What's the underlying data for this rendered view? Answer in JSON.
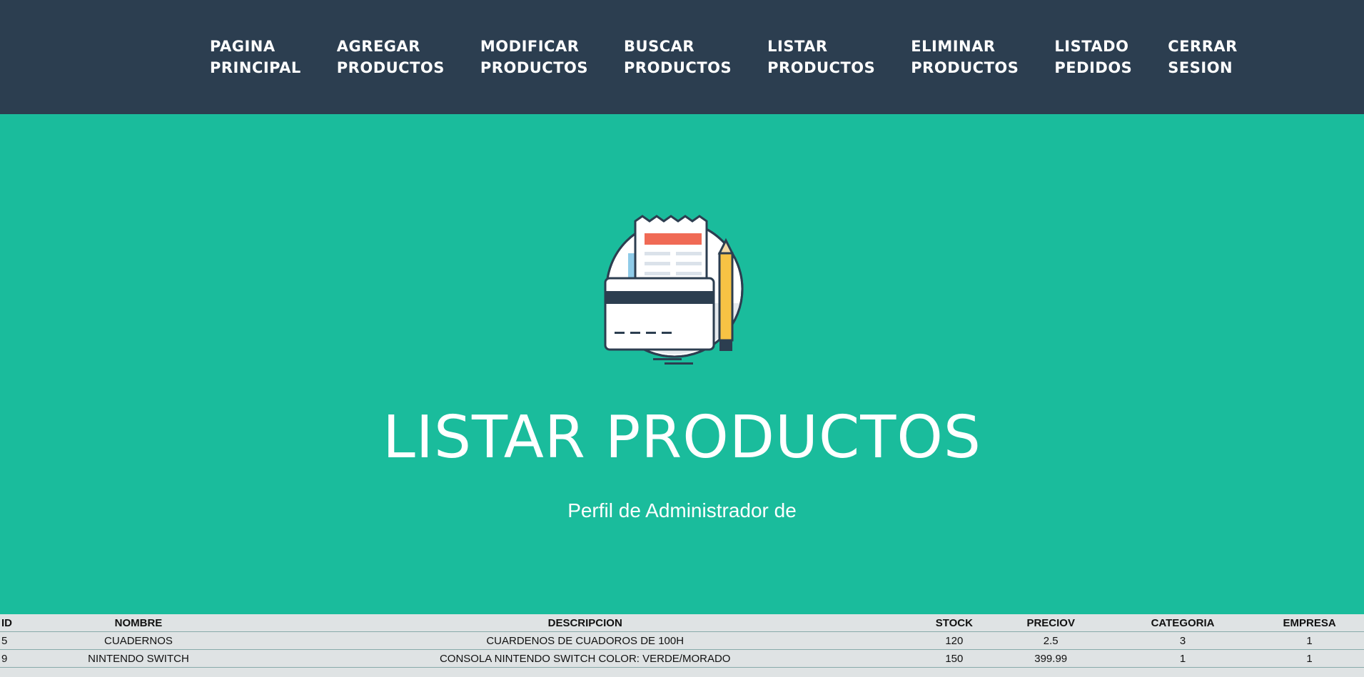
{
  "nav": {
    "items": [
      {
        "line1": "PAGINA",
        "line2": "PRINCIPAL"
      },
      {
        "line1": "AGREGAR",
        "line2": "PRODUCTOS"
      },
      {
        "line1": "MODIFICAR",
        "line2": "PRODUCTOS"
      },
      {
        "line1": "BUSCAR",
        "line2": "PRODUCTOS"
      },
      {
        "line1": "LISTAR",
        "line2": "PRODUCTOS"
      },
      {
        "line1": "ELIMINAR",
        "line2": "PRODUCTOS"
      },
      {
        "line1": "LISTADO",
        "line2": "PEDIDOS"
      },
      {
        "line1": "CERRAR",
        "line2": "SESION"
      }
    ]
  },
  "hero": {
    "illustration_icon": "payment-receipt-card-pencil-icon",
    "title": "LISTAR PRODUCTOS",
    "subtitle": "Perfil de Administrador de"
  },
  "colors": {
    "navbar": "#2c3e50",
    "hero": "#1abc9c",
    "table_bg": "#dfe3e4",
    "receipt_header": "#f06a55",
    "pencil": "#f7c344"
  },
  "table": {
    "headers": [
      "ID",
      "NOMBRE",
      "DESCRIPCION",
      "STOCK",
      "PRECIOV",
      "CATEGORIA",
      "EMPRESA"
    ],
    "rows": [
      [
        "5",
        "CUADERNOS",
        "CUARDENOS DE CUADOROS DE 100H",
        "120",
        "2.5",
        "3",
        "1"
      ],
      [
        "9",
        "NINTENDO SWITCH",
        "CONSOLA NINTENDO SWITCH COLOR: VERDE/MORADO",
        "150",
        "399.99",
        "1",
        "1"
      ]
    ]
  }
}
